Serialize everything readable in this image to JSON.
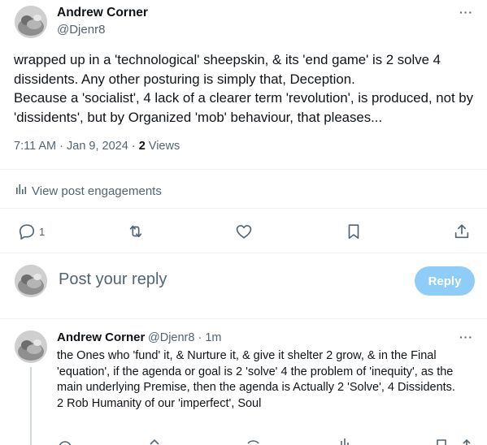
{
  "post": {
    "author_name": "Andrew Corner",
    "author_handle": "@Djenr8",
    "more_label": "···",
    "paragraphs": [
      "wrapped up in a 'technological' sheepskin, & its 'end game' is 2 solve 4 dissidents. Any other posturing is simply that, Deception.",
      "Because a 'socialist', 4 lack of a clearer term 'revolution', is produced, not by 'dissidents', but by Organized 'mob' behaviour, that pleases..."
    ],
    "timestamp": "7:11 AM · Jan 9, 2024 · ",
    "views_count": "2",
    "views_label": " Views",
    "engagements_label": "View post engagements",
    "reply_count": "1"
  },
  "compose": {
    "placeholder": "Post your reply",
    "button_label": "Reply"
  },
  "reply": {
    "author_name": "Andrew Corner",
    "author_handle": "@Djenr8 · 1m",
    "more_label": "···",
    "lines": [
      "the Ones who 'fund' it, & Nurture it, & give it shelter 2 grow, & in the Final 'equation', if the agenda or goal is 2 'solve' 4 the problem of 'inequity', as the main underlying Premise, then the agenda is Actually 2 'Solve', 4 Dissidents.",
      "2 Rob Humanity of our 'imperfect', Soul"
    ]
  },
  "colors": {
    "text_primary": "#0f1419",
    "text_secondary": "#536471",
    "reply_button_disabled": "#8ecdf8",
    "divider": "#eff3f4",
    "thread_line": "#cfd9de"
  }
}
